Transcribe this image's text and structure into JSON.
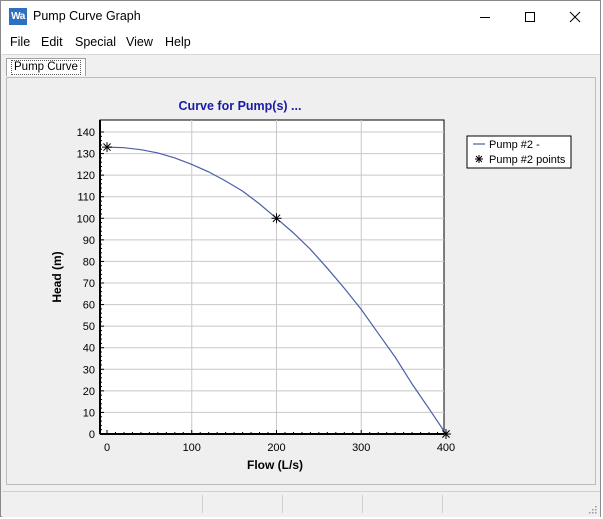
{
  "window": {
    "title": "Pump Curve Graph",
    "app_icon_text": "Wa",
    "controls": [
      "minimize-icon",
      "maximize-icon",
      "close-icon"
    ]
  },
  "menu": {
    "items": [
      "File",
      "Edit",
      "Special",
      "View",
      "Help"
    ]
  },
  "tabs": [
    {
      "label": "Pump Curve",
      "selected": true
    }
  ],
  "colors": {
    "title": "#1a1aa6",
    "line": "#4a5fa8",
    "plot_background": "#ffffff",
    "panel_background": "#efefef"
  },
  "chart_data": {
    "type": "line",
    "title": "Curve for Pump(s) ...",
    "xlabel": "Flow (L/s)",
    "ylabel": "Head (m)",
    "xlim": [
      0,
      400
    ],
    "ylim": [
      0,
      140
    ],
    "xticks": [
      0,
      100,
      200,
      300,
      400
    ],
    "yticks": [
      0,
      10,
      20,
      30,
      40,
      50,
      60,
      70,
      80,
      90,
      100,
      110,
      120,
      130,
      140
    ],
    "grid": true,
    "legend_position": "right",
    "series": [
      {
        "name": "Pump #2 -",
        "kind": "line",
        "x": [
          0,
          20,
          40,
          60,
          80,
          100,
          120,
          140,
          160,
          180,
          200,
          220,
          240,
          260,
          280,
          300,
          320,
          340,
          360,
          380,
          400
        ],
        "y": [
          133,
          132.7,
          131.8,
          130.3,
          128,
          125,
          121.5,
          117.3,
          112.6,
          106.6,
          100,
          93.2,
          85.6,
          76.8,
          67.6,
          57.7,
          46.7,
          35.7,
          23.2,
          11.7,
          0
        ]
      },
      {
        "name": "Pump #2 points",
        "kind": "points",
        "x": [
          0,
          200,
          400
        ],
        "y": [
          133,
          100,
          0
        ]
      }
    ]
  }
}
